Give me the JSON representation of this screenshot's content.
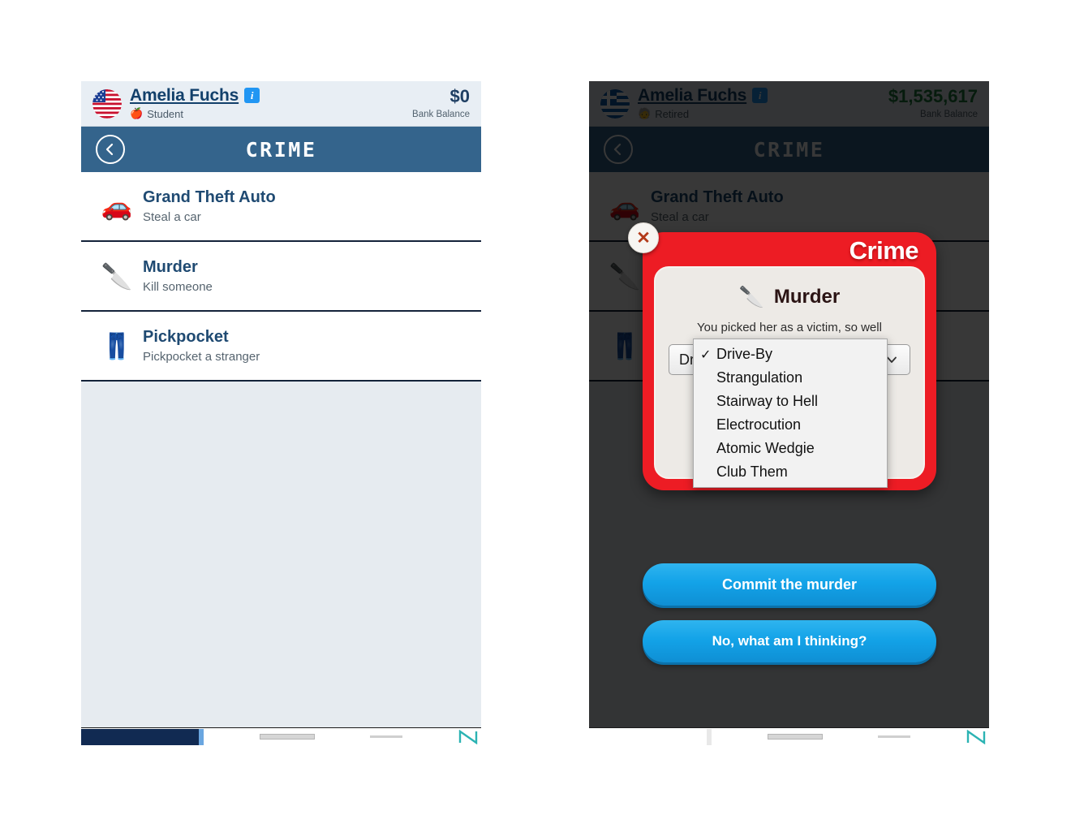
{
  "app": {
    "title": "CRIME",
    "back_icon": "chevron-left-icon"
  },
  "left_panel": {
    "player": {
      "flag": "us-flag-icon",
      "name": "Amelia Fuchs",
      "info_badge": "i",
      "job_emoji": "🍎",
      "job": "Student",
      "money": "$0",
      "money_label": "Bank Balance"
    },
    "titlebar": {
      "title": "CRIME"
    },
    "crimes": [
      {
        "icon": "🚗",
        "icon_name": "car-icon",
        "name": "Grand Theft Auto",
        "desc": "Steal a car"
      },
      {
        "icon": "🔪",
        "icon_name": "knife-icon",
        "name": "Murder",
        "desc": "Kill someone"
      },
      {
        "icon": "👖",
        "icon_name": "jeans-icon",
        "name": "Pickpocket",
        "desc": "Pickpocket a stranger"
      }
    ]
  },
  "right_panel": {
    "player": {
      "flag": "greece-flag-icon",
      "name": "Amelia Fuchs",
      "info_badge": "i",
      "job_emoji": "🧓",
      "job": "Retired",
      "money": "$1,535,617",
      "money_label": "Bank Balance"
    },
    "titlebar": {
      "title": "CRIME"
    },
    "crimes": [
      {
        "icon": "🚗",
        "icon_name": "car-icon",
        "name": "Grand Theft Auto",
        "desc": "Steal a car"
      },
      {
        "icon": "🔪",
        "icon_name": "knife-icon",
        "name": "Murder",
        "desc": "Kill someone"
      },
      {
        "icon": "👖",
        "icon_name": "jeans-icon",
        "name": "Pickpocket",
        "desc": "Pickpocket a stranger"
      }
    ]
  },
  "modal": {
    "header_title": "Crime",
    "close_icon": "close-x-icon",
    "crime_emoji": "🔪",
    "crime_title": "Murder",
    "prompt": "You picked her as a victim, so well",
    "select": {
      "value": "Drive-By",
      "chevron": "chevron-down-icon",
      "options": [
        {
          "label": "Drive-By",
          "checked": true
        },
        {
          "label": "Strangulation",
          "checked": false
        },
        {
          "label": "Stairway to Hell",
          "checked": false
        },
        {
          "label": "Electrocution",
          "checked": false
        },
        {
          "label": "Atomic Wedgie",
          "checked": false
        },
        {
          "label": "Club Them",
          "checked": false
        }
      ],
      "check_glyph": "✓"
    },
    "confirm_label": "Commit the murder",
    "cancel_label": "No, what am I thinking?"
  },
  "colors": {
    "titlebar_blue": "#34648c",
    "modal_red": "#ed1c24",
    "button_blue": "#13a3e8",
    "money_green": "#1f7a3d",
    "money_navy": "#1f3f63"
  }
}
